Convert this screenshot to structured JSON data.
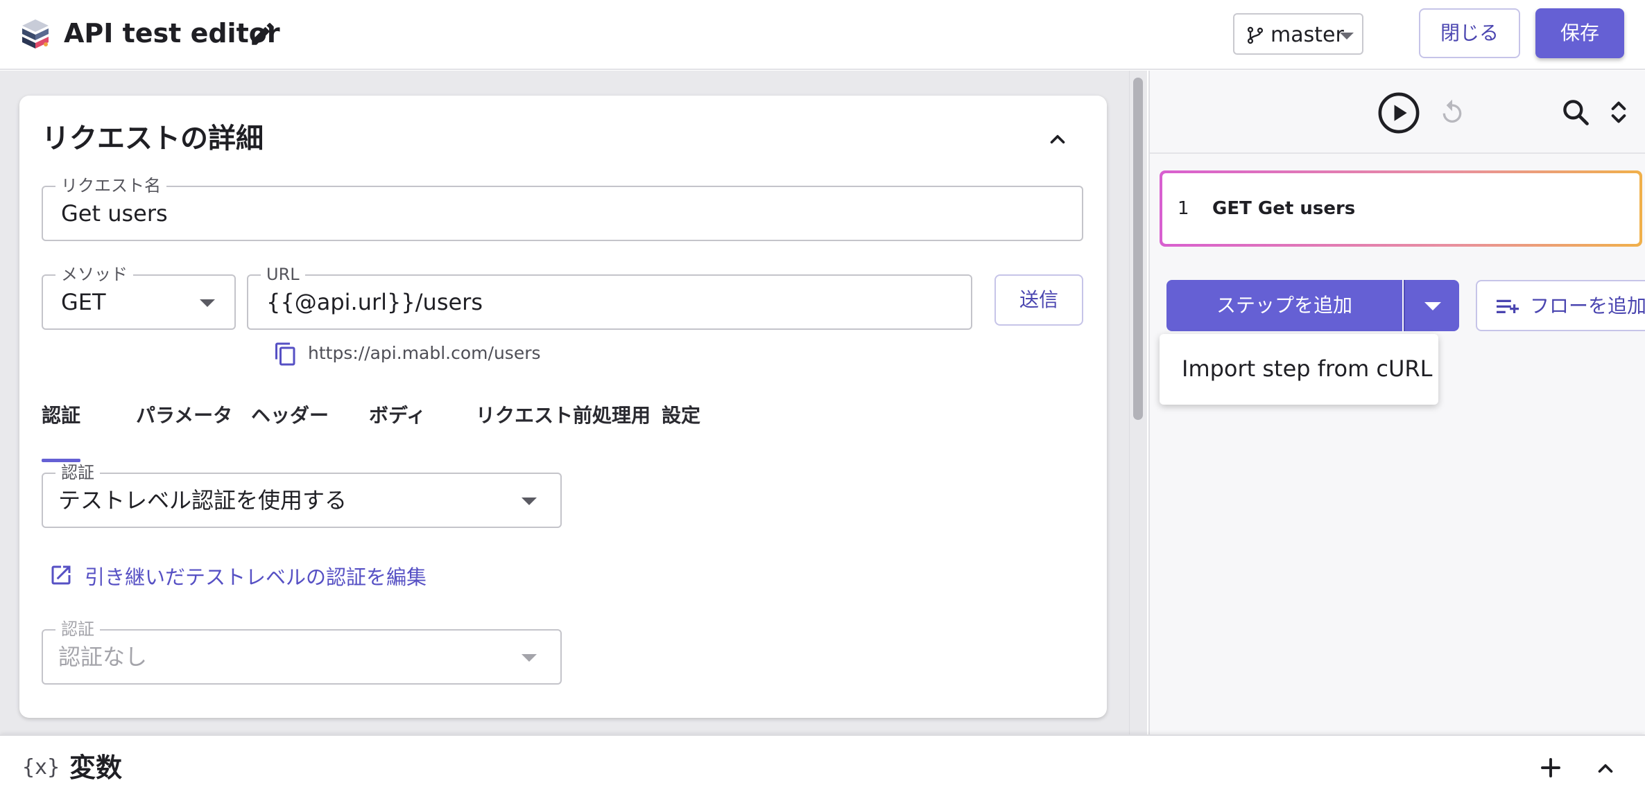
{
  "header": {
    "app_title": "API test editor",
    "branch": "master",
    "close_label": "閉じる",
    "save_label": "保存"
  },
  "request": {
    "title": "リクエストの詳細",
    "name_label": "リクエスト名",
    "name_value": "Get users",
    "method_label": "メソッド",
    "method_value": "GET",
    "url_label": "URL",
    "url_value": "{{@api.url}}/users",
    "send_label": "送信",
    "resolved_url": "https://api.mabl.com/users",
    "tabs": [
      {
        "label": "認証",
        "active": true
      },
      {
        "label": "パラメータ"
      },
      {
        "label": "ヘッダー"
      },
      {
        "label": "ボディ"
      },
      {
        "label": "リクエスト前処理用"
      },
      {
        "label": "設定"
      }
    ],
    "auth_label": "認証",
    "auth_value": "テストレベル認証を使用する",
    "edit_auth_link": "引き継いだテストレベルの認証を編集",
    "auth_inherited_label": "認証",
    "auth_inherited_value": "認証なし"
  },
  "steps": {
    "items": [
      {
        "number": "1",
        "label": "GET Get users"
      }
    ],
    "add_step_label": "ステップを追加",
    "add_flow_label": "フローを追加",
    "menu_items": [
      "Import step from cURL"
    ]
  },
  "variables": {
    "icon_text": "{x}",
    "title": "変数"
  },
  "colors": {
    "accent": "#6560d4",
    "accent_text": "#4a45b0",
    "link": "#5650c4"
  }
}
